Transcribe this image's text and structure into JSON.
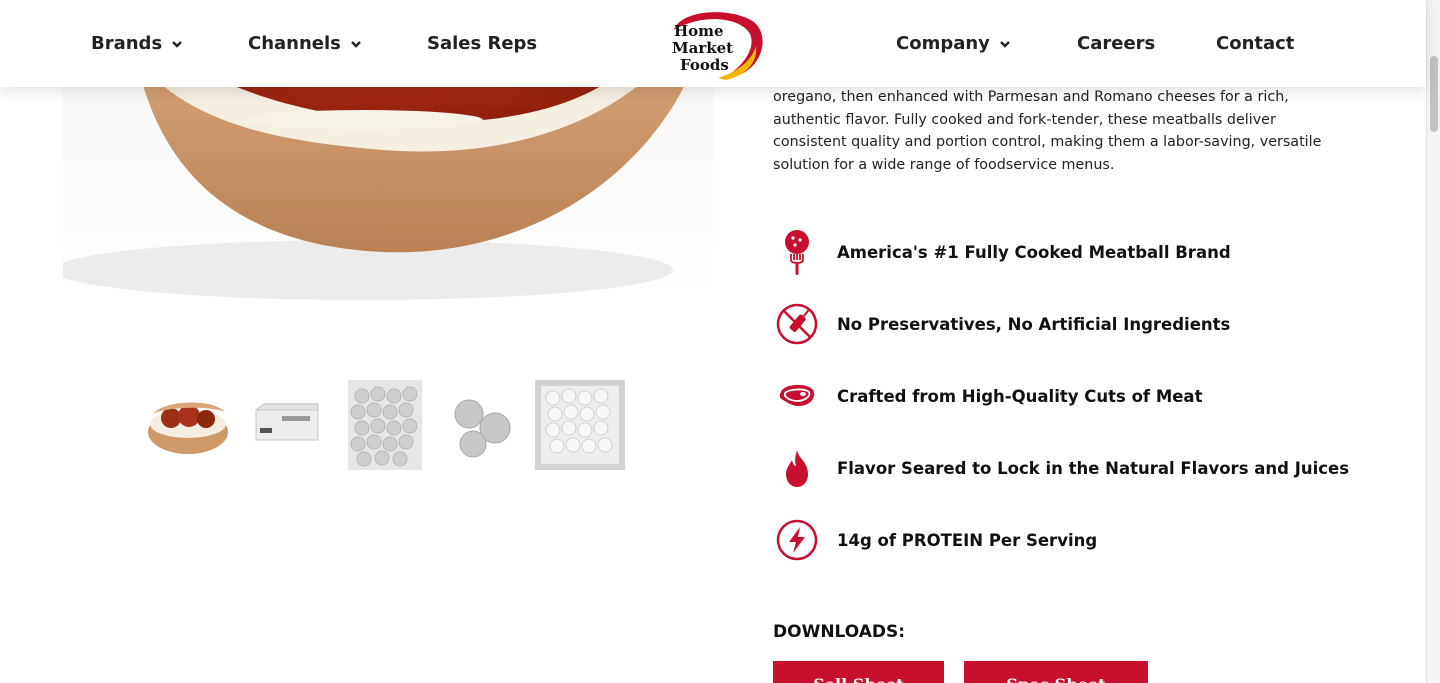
{
  "nav": {
    "brands": "Brands",
    "channels": "Channels",
    "sales_reps": "Sales Reps",
    "company": "Company",
    "careers": "Careers",
    "contact": "Contact"
  },
  "logo": {
    "line1": "Home",
    "line2": "Market",
    "line3": "Foods"
  },
  "description": "oregano, then enhanced with Parmesan and Romano cheeses for a rich, authentic flavor. Fully cooked and fork-tender, these meatballs deliver consistent quality and portion control, making them a labor-saving, versatile solution for a wide range of foodservice menus.",
  "features": [
    {
      "icon": "meatball-fork-icon",
      "text": "America's #1 Fully Cooked Meatball Brand"
    },
    {
      "icon": "no-preservatives-icon",
      "text": "No Preservatives, No Artificial Ingredients"
    },
    {
      "icon": "steak-icon",
      "text": "Crafted from High-Quality Cuts of Meat"
    },
    {
      "icon": "flame-icon",
      "text": "Flavor Seared to Lock in the Natural Flavors and Juices"
    },
    {
      "icon": "lightning-bolt-icon",
      "text": "14g of PROTEIN Per Serving"
    }
  ],
  "downloads": {
    "title": "DOWNLOADS:",
    "buttons": [
      "Sell Sheet",
      "Spec Sheet"
    ]
  },
  "colors": {
    "brand_red": "#c8102e",
    "logo_yellow": "#f2b705"
  }
}
